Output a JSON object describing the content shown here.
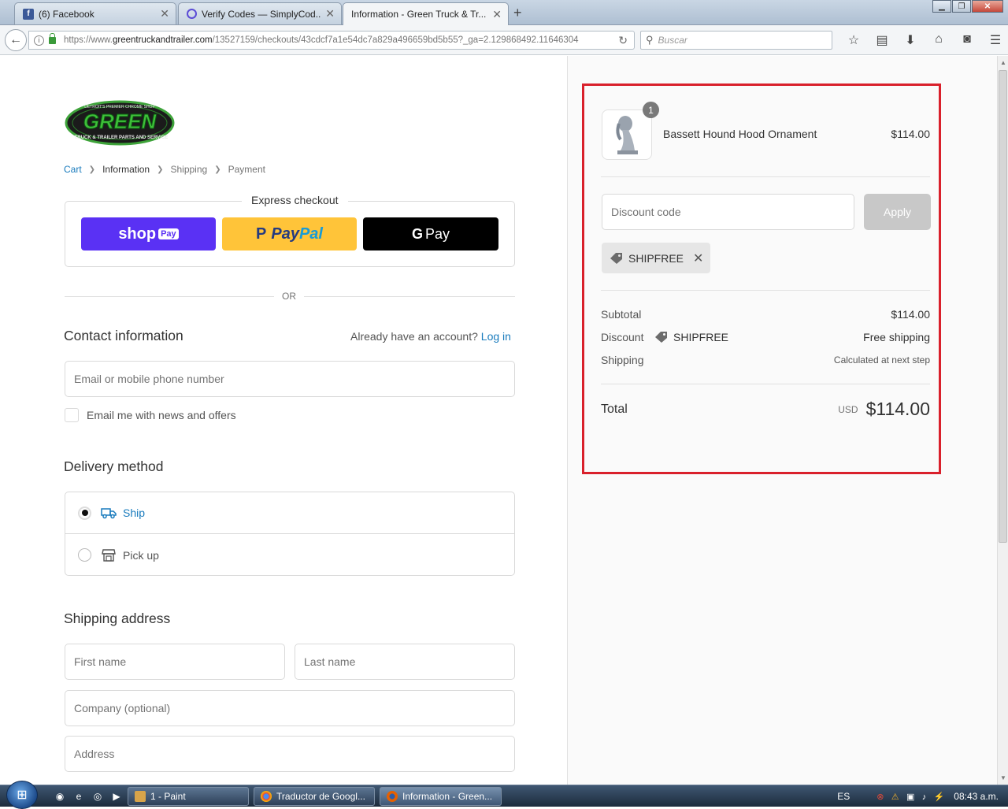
{
  "browser": {
    "tabs": [
      {
        "title": "(6) Facebook",
        "icon": "facebook-icon"
      },
      {
        "title": "Verify Codes — SimplyCod...",
        "icon": "simplycodes-icon"
      },
      {
        "title": "Information - Green Truck & Tr...",
        "icon": "none",
        "active": true
      }
    ],
    "new_tab": "+",
    "url_domain": "greentruckandtrailer.com",
    "url_prefix": "https://www.",
    "url_path": "/13527159/checkouts/43cdcf7a1e54dc7a829a496659bd5b55?_ga=2.129868492.11646304",
    "search_placeholder": "Buscar"
  },
  "checkout": {
    "logo_text": "GREEN",
    "logo_subtext": "TRUCK & TRAILER PARTS AND SERVICE",
    "logo_tagline": "DETROIT'S PREMIER CHROME SHOP",
    "breadcrumb": [
      "Cart",
      "Information",
      "Shipping",
      "Payment"
    ],
    "express_title": "Express checkout",
    "shop_pay_label": "shop",
    "shop_pay_tag": "Pay",
    "paypal_pay": "Pay",
    "paypal_pal": "Pal",
    "gpay_label": "Pay",
    "gpay_g": "G",
    "or_text": "OR",
    "contact_title": "Contact information",
    "account_prompt": "Already have an account?",
    "login_link": "Log in",
    "email_placeholder": "Email or mobile phone number",
    "news_checkbox_label": "Email me with news and offers",
    "delivery_title": "Delivery method",
    "delivery_options": [
      {
        "label": "Ship",
        "selected": true,
        "icon": "truck-icon"
      },
      {
        "label": "Pick up",
        "selected": false,
        "icon": "store-icon"
      }
    ],
    "shipping_title": "Shipping address",
    "first_name_placeholder": "First name",
    "last_name_placeholder": "Last name",
    "company_placeholder": "Company (optional)",
    "address_placeholder": "Address"
  },
  "summary": {
    "product": {
      "name": "Bassett Hound Hood Ornament",
      "price": "$114.00",
      "quantity": "1"
    },
    "discount_placeholder": "Discount code",
    "apply_label": "Apply",
    "applied_code": "SHIPFREE",
    "subtotal_label": "Subtotal",
    "subtotal_value": "$114.00",
    "discount_label": "Discount",
    "discount_code": "SHIPFREE",
    "discount_value": "Free shipping",
    "shipping_label": "Shipping",
    "shipping_value": "Calculated at next step",
    "total_label": "Total",
    "total_currency": "USD",
    "total_value": "$114.00",
    "highlight_color": "#d9202b"
  },
  "taskbar": {
    "tasks": [
      {
        "label": "1 - Paint",
        "icon": "paint-icon"
      },
      {
        "label": "Traductor de Googl...",
        "icon": "chrome-icon"
      },
      {
        "label": "Information - Green...",
        "icon": "firefox-icon",
        "active": true
      }
    ],
    "language": "ES",
    "time": "08:43 a.m."
  },
  "colors": {
    "link": "#197bbd",
    "shop_pay": "#5a31f4",
    "paypal": "#ffc439"
  }
}
